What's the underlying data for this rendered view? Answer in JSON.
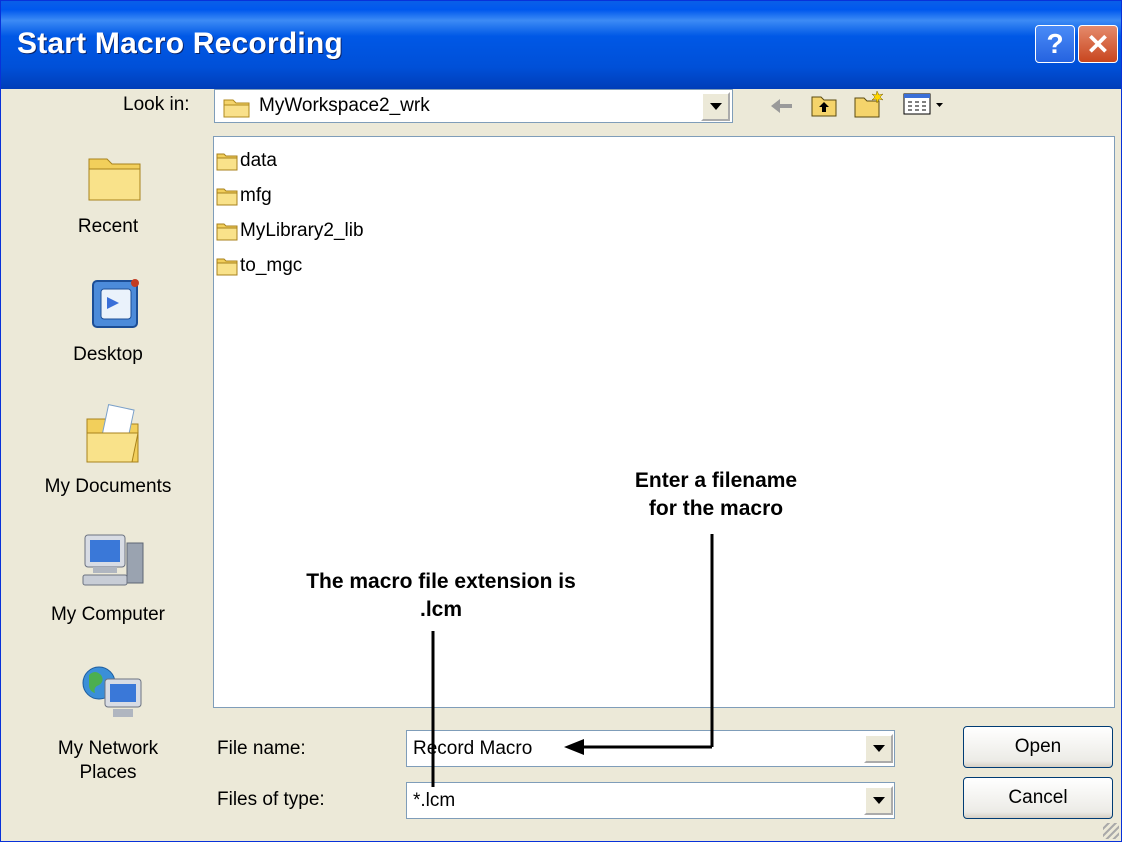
{
  "window": {
    "title": "Start Macro Recording",
    "help_label": "?",
    "close_label": "✕"
  },
  "lookin": {
    "label": "Look in:",
    "value": "MyWorkspace2_wrk"
  },
  "toolbar": {
    "back_icon": "back-arrow-icon",
    "up_icon": "up-folder-icon",
    "newfolder_icon": "new-folder-icon",
    "views_icon": "views-menu-icon"
  },
  "places": [
    {
      "label": "Recent",
      "icon": "recent-folder-icon"
    },
    {
      "label": "Desktop",
      "icon": "desktop-icon"
    },
    {
      "label": "My Documents",
      "icon": "my-documents-icon"
    },
    {
      "label": "My Computer",
      "icon": "my-computer-icon"
    },
    {
      "label": "My Network Places",
      "icon": "network-places-icon"
    }
  ],
  "files": [
    {
      "name": "data"
    },
    {
      "name": "mfg"
    },
    {
      "name": "MyLibrary2_lib"
    },
    {
      "name": "to_mgc"
    }
  ],
  "filename": {
    "label": "File name:",
    "value": "Record Macro"
  },
  "filetype": {
    "label": "Files of type:",
    "value": "*.lcm"
  },
  "buttons": {
    "open": "Open",
    "cancel": "Cancel"
  },
  "annotations": {
    "filename_note_line1": "Enter a filename",
    "filename_note_line2": "for the macro",
    "extension_note_line1": "The macro file extension is",
    "extension_note_line2": ".lcm"
  }
}
